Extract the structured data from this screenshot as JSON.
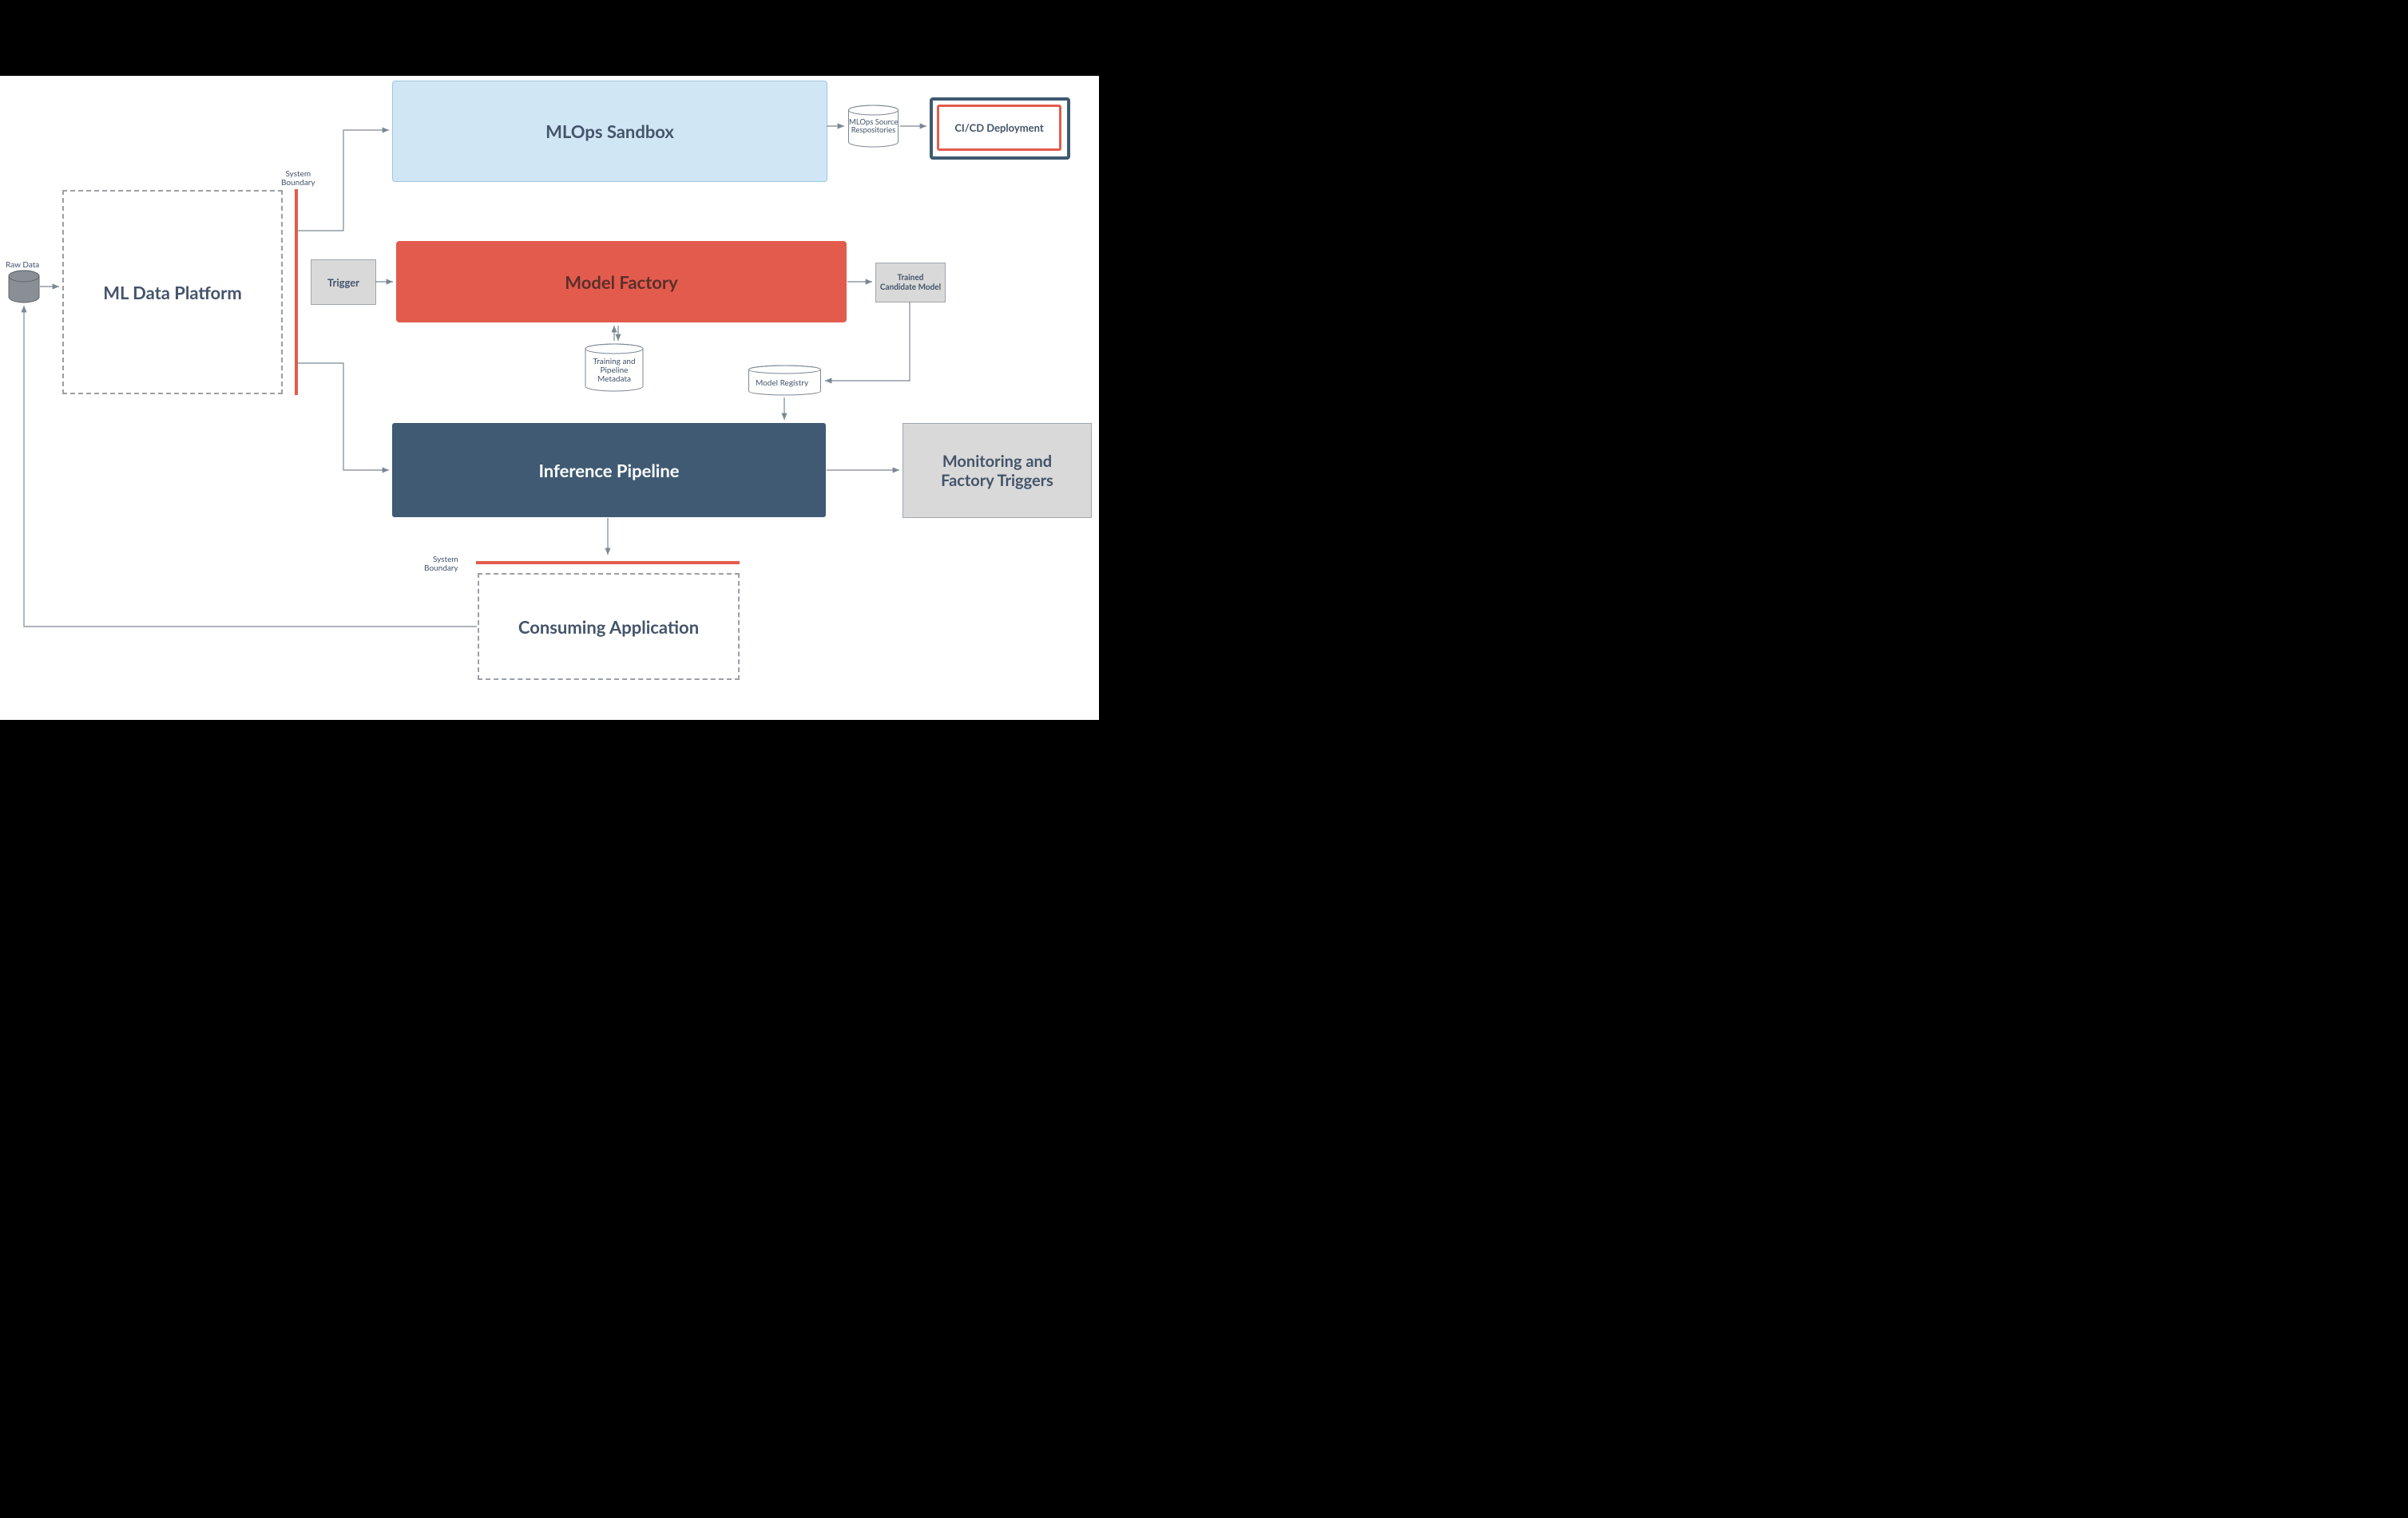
{
  "labels": {
    "raw_data": "Raw Data",
    "system_boundary_top": "System\nBoundary",
    "system_boundary_bottom": "System\nBoundary"
  },
  "boxes": {
    "ml_data_platform": "ML Data Platform",
    "mlops_sandbox": "MLOps Sandbox",
    "trigger": "Trigger",
    "model_factory": "Model Factory",
    "inference_pipeline": "Inference Pipeline",
    "consuming_application": "Consuming Application",
    "cicd_deployment": "CI/CD Deployment",
    "trained_candidate_model": "Trained\nCandidate Model",
    "monitoring_factory_triggers": "Monitoring and\nFactory Triggers"
  },
  "cylinders": {
    "mlops_source_repos": "MLOps Source\nRespositories",
    "training_pipeline_metadata": "Training and\nPipeline\nMetadata",
    "model_registry": "Model Registry"
  },
  "colors": {
    "sandbox_fill": "#d1e6f5",
    "sandbox_stroke": "#9ec7e3",
    "factory_fill": "#e35b4d",
    "pipeline_fill": "#3f5a72",
    "grey_fill": "#d9d9d9",
    "grey_stroke": "#9fa6ad",
    "text_dark": "#44546a",
    "boundary_red": "#e35b4d"
  }
}
